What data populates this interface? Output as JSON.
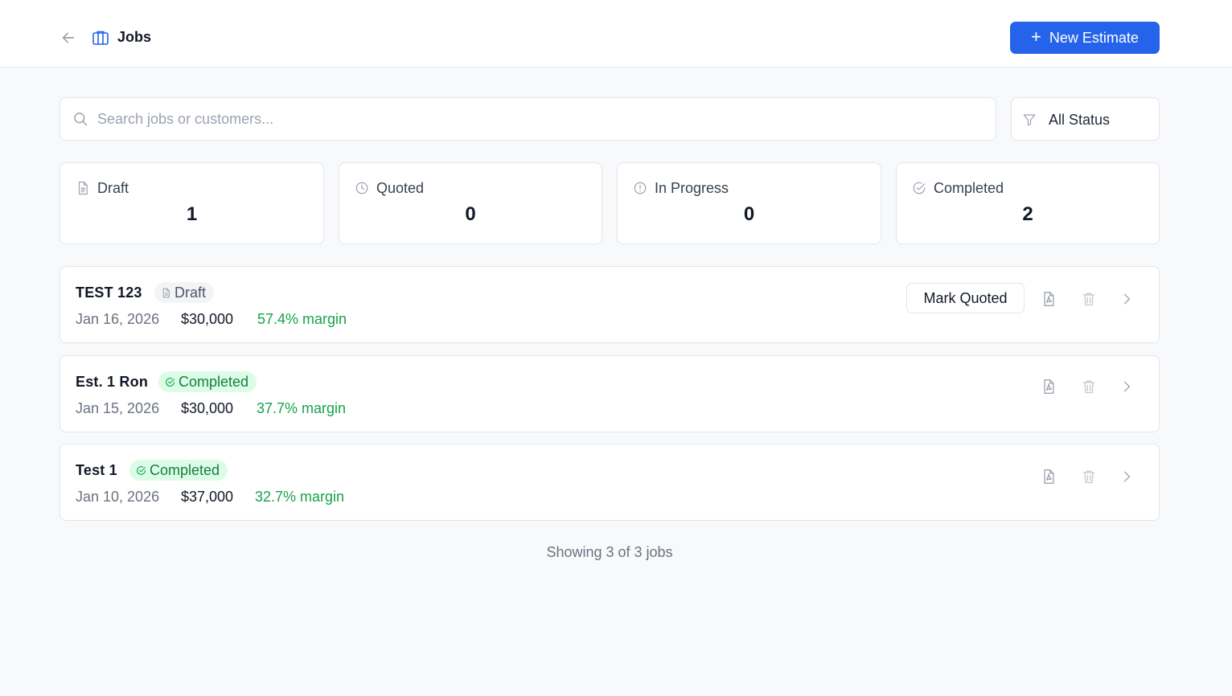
{
  "header": {
    "title": "Jobs",
    "new_button_label": "New Estimate",
    "accent_color": "#2563eb"
  },
  "search": {
    "placeholder": "Search jobs or customers...",
    "value": ""
  },
  "filter": {
    "selected": "All Status"
  },
  "stats": [
    {
      "label": "Draft",
      "value": "1",
      "icon": "document-icon"
    },
    {
      "label": "Quoted",
      "value": "0",
      "icon": "clock-icon"
    },
    {
      "label": "In Progress",
      "value": "0",
      "icon": "alert-circle-icon"
    },
    {
      "label": "Completed",
      "value": "2",
      "icon": "check-circle-icon"
    }
  ],
  "jobs": [
    {
      "name": "TEST 123",
      "status": "Draft",
      "date": "Jan 16, 2026",
      "amount": "$30,000",
      "margin": "57.4% margin",
      "action_label": "Mark Quoted"
    },
    {
      "name": "Est. 1 Ron",
      "status": "Completed",
      "date": "Jan 15, 2026",
      "amount": "$30,000",
      "margin": "37.7% margin"
    },
    {
      "name": "Test 1",
      "status": "Completed",
      "date": "Jan 10, 2026",
      "amount": "$37,000",
      "margin": "32.7% margin"
    }
  ],
  "footer": {
    "count_text": "Showing 3 of 3 jobs"
  },
  "colors": {
    "completed_badge_bg": "#dcfce7",
    "completed_badge_text": "#15803d",
    "margin_text": "#16a34a",
    "draft_badge_bg": "#f3f4f6"
  }
}
